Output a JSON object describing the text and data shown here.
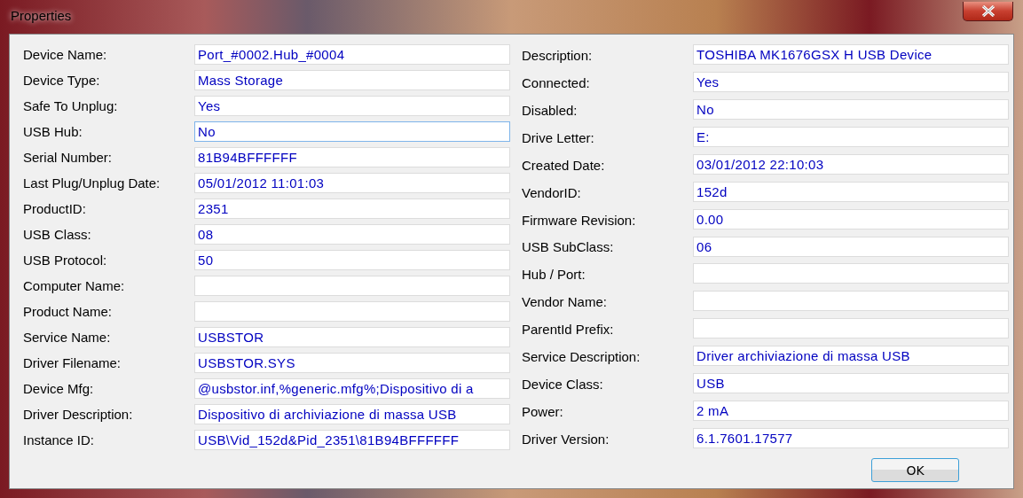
{
  "window": {
    "title": "Properties"
  },
  "left_fields": [
    {
      "label": "Device Name:",
      "value": "Port_#0002.Hub_#0004",
      "focused": false
    },
    {
      "label": "Device Type:",
      "value": "Mass Storage",
      "focused": false
    },
    {
      "label": "Safe To Unplug:",
      "value": "Yes",
      "focused": false
    },
    {
      "label": "USB Hub:",
      "value": "No",
      "focused": true
    },
    {
      "label": "Serial Number:",
      "value": "81B94BFFFFFF",
      "focused": false
    },
    {
      "label": "Last Plug/Unplug Date:",
      "value": "05/01/2012 11:01:03",
      "focused": false
    },
    {
      "label": "ProductID:",
      "value": "2351",
      "focused": false
    },
    {
      "label": "USB Class:",
      "value": "08",
      "focused": false
    },
    {
      "label": "USB Protocol:",
      "value": "50",
      "focused": false
    },
    {
      "label": "Computer Name:",
      "focused": false
    },
    {
      "label": "Product Name:",
      "focused": false
    },
    {
      "label": "Service Name:",
      "value": "USBSTOR",
      "focused": false
    },
    {
      "label": "Driver Filename:",
      "value": "USBSTOR.SYS",
      "focused": false
    },
    {
      "label": "Device Mfg:",
      "value": "@usbstor.inf,%generic.mfg%;Dispositivo di a",
      "focused": false
    },
    {
      "label": "Driver Description:",
      "value": "Dispositivo di archiviazione di massa USB",
      "focused": false
    },
    {
      "label": "Instance ID:",
      "value": "USB\\Vid_152d&Pid_2351\\81B94BFFFFFF",
      "focused": false
    }
  ],
  "right_fields": [
    {
      "label": "Description:",
      "value": "TOSHIBA MK1676GSX H USB Device",
      "focused": false
    },
    {
      "label": "Connected:",
      "value": "Yes",
      "focused": false
    },
    {
      "label": "Disabled:",
      "value": "No",
      "focused": false
    },
    {
      "label": "Drive Letter:",
      "value": "E:",
      "focused": false
    },
    {
      "label": "Created Date:",
      "value": "03/01/2012 22:10:03",
      "focused": false
    },
    {
      "label": "VendorID:",
      "value": "152d",
      "focused": false
    },
    {
      "label": "Firmware Revision:",
      "value": "0.00",
      "focused": false
    },
    {
      "label": "USB SubClass:",
      "value": "06",
      "focused": false
    },
    {
      "label": "Hub / Port:",
      "focused": false
    },
    {
      "label": "Vendor Name:",
      "focused": false
    },
    {
      "label": "ParentId Prefix:",
      "focused": false
    },
    {
      "label": "Service Description:",
      "value": "Driver archiviazione di massa USB",
      "focused": false
    },
    {
      "label": "Device Class:",
      "value": "USB",
      "focused": false
    },
    {
      "label": "Power:",
      "value": "2 mA",
      "focused": false
    },
    {
      "label": "Driver Version:",
      "value": "6.1.7601.17577",
      "focused": false
    }
  ],
  "buttons": [
    "OK"
  ]
}
